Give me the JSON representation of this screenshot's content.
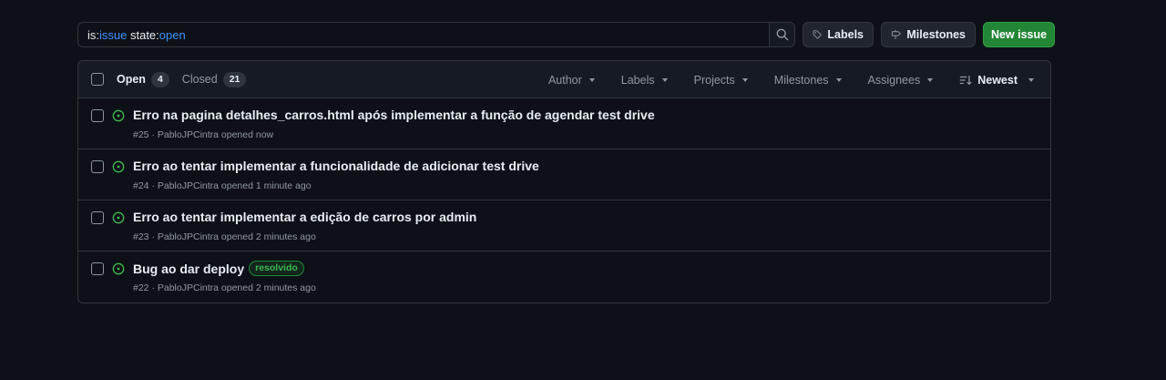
{
  "search": {
    "segments": [
      {
        "text": "is:",
        "kind": "key"
      },
      {
        "text": "issue",
        "kind": "value"
      },
      {
        "text": " state:",
        "kind": "key"
      },
      {
        "text": "open",
        "kind": "value"
      }
    ]
  },
  "toolbar": {
    "labels_label": "Labels",
    "milestones_label": "Milestones",
    "new_issue_label": "New issue"
  },
  "header": {
    "open_label": "Open",
    "open_count": "4",
    "closed_label": "Closed",
    "closed_count": "21",
    "filters": {
      "author": "Author",
      "labels": "Labels",
      "projects": "Projects",
      "milestones": "Milestones",
      "assignees": "Assignees",
      "sort": "Newest"
    }
  },
  "issues": [
    {
      "title": "Erro na pagina detalhes_carros.html após implementar a função de agendar test drive",
      "number": "#25",
      "sep": " · ",
      "author": "PabloJPCintra",
      "action": " opened now",
      "label": ""
    },
    {
      "title": "Erro ao tentar implementar a funcionalidade de adicionar test drive",
      "number": "#24",
      "sep": " · ",
      "author": "PabloJPCintra",
      "action": " opened 1 minute ago",
      "label": ""
    },
    {
      "title": "Erro ao tentar implementar a edição de carros por admin",
      "number": "#23",
      "sep": " · ",
      "author": "PabloJPCintra",
      "action": " opened 2 minutes ago",
      "label": ""
    },
    {
      "title": "Bug ao dar deploy",
      "number": "#22",
      "sep": " · ",
      "author": "PabloJPCintra",
      "action": " opened 2 minutes ago",
      "label": "resolvido"
    }
  ],
  "colors": {
    "background": "#0d1117",
    "header_bg": "#161b22",
    "border": "#30363d",
    "open_icon": "#3fb950",
    "primary_button": "#238636",
    "query_value": "#4493f8"
  },
  "icons": {
    "search": "search-icon",
    "labels": "tag-icon",
    "milestones": "milestone-icon",
    "sort": "sort-icon",
    "issue_state": "issue-opened-icon"
  }
}
